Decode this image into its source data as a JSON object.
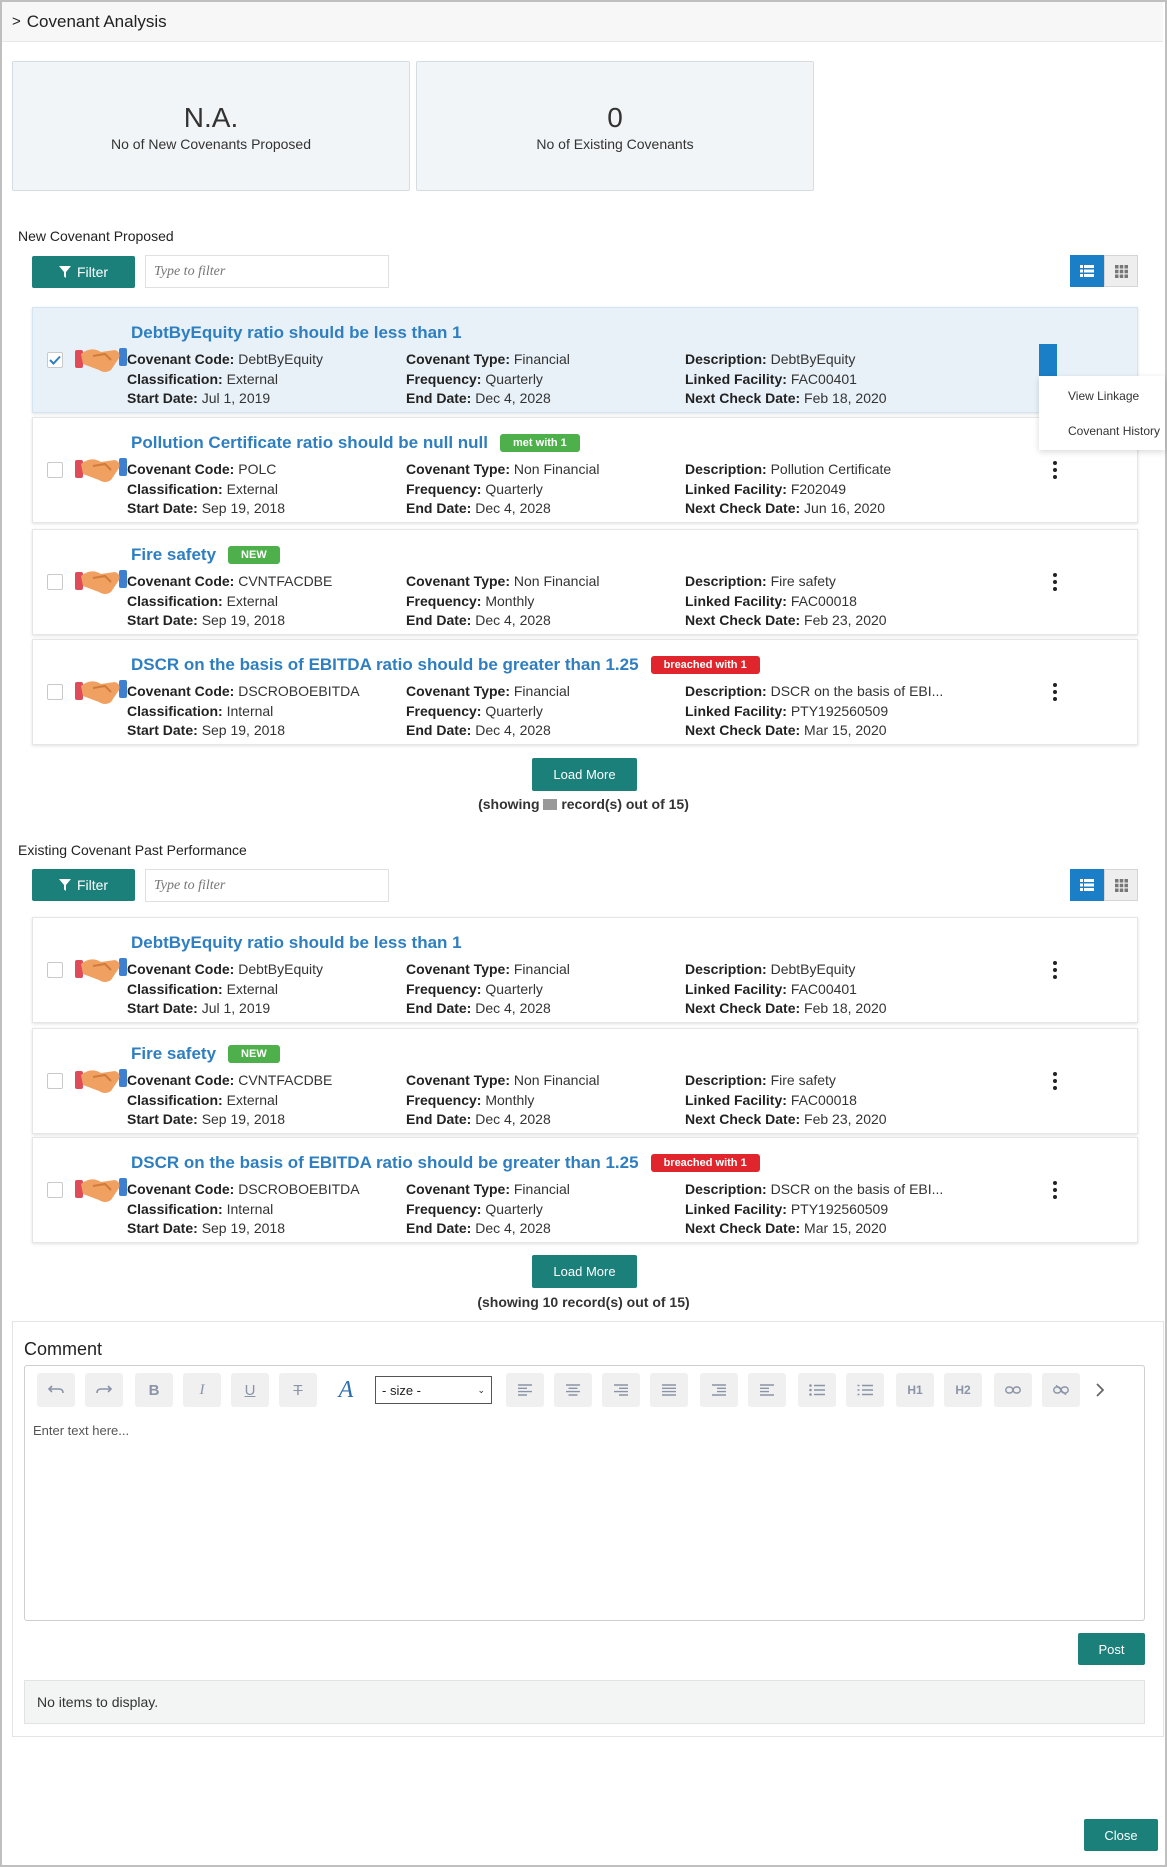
{
  "header": {
    "title": "Covenant Analysis",
    "toggle_icon": "chevron-right-icon"
  },
  "stats": [
    {
      "value": "N.A.",
      "label": "No of New Covenants Proposed"
    },
    {
      "value": "0",
      "label": "No of Existing Covenants"
    }
  ],
  "labels": {
    "code": "Covenant Code:",
    "classification": "Classification:",
    "start": "Start Date:",
    "type": "Covenant Type:",
    "frequency": "Frequency:",
    "end": "End Date:",
    "description": "Description:",
    "facility": "Linked Facility:",
    "next": "Next Check Date:"
  },
  "new_section": {
    "title": "New Covenant Proposed",
    "filter_label": "Filter",
    "filter_placeholder": "Type to filter",
    "cards": [
      {
        "title": "DebtByEquity ratio should be less than 1",
        "badge": "",
        "code": "DebtByEquity",
        "classification": "External",
        "start": "Jul 1, 2019",
        "type": "Financial",
        "frequency": "Quarterly",
        "end": "Dec 4, 2028",
        "description": "DebtByEquity",
        "facility": "FAC00401",
        "next": "Feb 18, 2020",
        "checked": true
      },
      {
        "title": "Pollution Certificate ratio should be null null",
        "badge": "met with 1",
        "code": "POLC",
        "classification": "External",
        "start": "Sep 19, 2018",
        "type": "Non Financial",
        "frequency": "Quarterly",
        "end": "Dec 4, 2028",
        "description": "Pollution Certificate",
        "facility": "F202049",
        "next": "Jun 16, 2020",
        "checked": false
      },
      {
        "title": "Fire safety",
        "badge": "NEW",
        "code": "CVNTFACDBE",
        "classification": "External",
        "start": "Sep 19, 2018",
        "type": "Non Financial",
        "frequency": "Monthly",
        "end": "Dec 4, 2028",
        "description": "Fire safety",
        "facility": "FAC00018",
        "next": "Feb 23, 2020",
        "checked": false
      },
      {
        "title": "DSCR on the basis of EBITDA ratio should be greater than 1.25",
        "badge": "breached with 1",
        "code": "DSCROBOEBITDA",
        "classification": "Internal",
        "start": "Sep 19, 2018",
        "type": "Financial",
        "frequency": "Quarterly",
        "end": "Dec 4, 2028",
        "description": "DSCR on the basis of EBI...",
        "facility": "PTY192560509",
        "next": "Mar 15, 2020",
        "checked": false
      }
    ],
    "load_more": "Load More",
    "showing_prefix": "(showing",
    "showing_suffix": "record(s) out of 15)",
    "menu": {
      "view_linkage": "View Linkage",
      "history": "Covenant History"
    }
  },
  "existing_section": {
    "title": "Existing Covenant Past Performance",
    "filter_label": "Filter",
    "filter_placeholder": "Type to filter",
    "cards": [
      {
        "title": "DebtByEquity ratio should be less than 1",
        "badge": "",
        "code": "DebtByEquity",
        "classification": "External",
        "start": "Jul 1, 2019",
        "type": "Financial",
        "frequency": "Quarterly",
        "end": "Dec 4, 2028",
        "description": "DebtByEquity",
        "facility": "FAC00401",
        "next": "Feb 18, 2020",
        "checked": false
      },
      {
        "title": "Fire safety",
        "badge": "NEW",
        "code": "CVNTFACDBE",
        "classification": "External",
        "start": "Sep 19, 2018",
        "type": "Non Financial",
        "frequency": "Monthly",
        "end": "Dec 4, 2028",
        "description": "Fire safety",
        "facility": "FAC00018",
        "next": "Feb 23, 2020",
        "checked": false
      },
      {
        "title": "DSCR on the basis of EBITDA ratio should be greater than 1.25",
        "badge": "breached with 1",
        "code": "DSCROBOEBITDA",
        "classification": "Internal",
        "start": "Sep 19, 2018",
        "type": "Financial",
        "frequency": "Quarterly",
        "end": "Dec 4, 2028",
        "description": "DSCR on the basis of EBI...",
        "facility": "PTY192560509",
        "next": "Mar 15, 2020",
        "checked": false
      }
    ],
    "load_more": "Load More",
    "showing": "(showing 10 record(s) out of 15)"
  },
  "comment": {
    "title": "Comment",
    "size_select": "- size -",
    "placeholder": "Enter text here...",
    "h1": "H1",
    "h2": "H2",
    "post": "Post",
    "no_items": "No items to display."
  },
  "footer": {
    "close": "Close"
  },
  "colors": {
    "primary_teal": "#1b7f7a",
    "link_blue": "#2f7fc0",
    "active_blue": "#1a7fc7",
    "green_badge": "#4db04a",
    "red_badge": "#e0262c"
  }
}
